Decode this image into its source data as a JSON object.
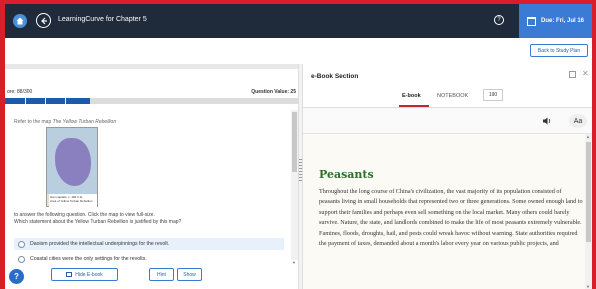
{
  "topbar": {
    "title": "LearningCurve for Chapter 5",
    "help_glyph": "?",
    "due_label": "Due: Fri, Jul 16"
  },
  "study_plan_button": "Back to Study Plan",
  "score": {
    "label": "ore: 88/300",
    "question_value": "Question Value: 25",
    "progress_fraction": 0.29
  },
  "question": {
    "refer_prefix": "Refer to the map ",
    "refer_italic": "The Yellow Turban Rebellion",
    "map_legend_1": "Han capitals, c. 184 C.E.",
    "map_legend_2": "Area of Yellow Turban Rebellion",
    "instruction_1": "to answer the following question. Click the map to view full-size.",
    "instruction_2": "Which statement about the Yellow Turban Rebellion is justified by this map?",
    "options": [
      "Daoism provided the intellectual underpinnings for the revolt.",
      "Coastal cities were the only settings for the revolts."
    ]
  },
  "buttons": {
    "hide_ebook": "Hide E-book",
    "hint": "Hint",
    "show": "Show"
  },
  "help_fab": "?",
  "ebook": {
    "section_title": "e-Book Section",
    "tab_ebook": "E-book",
    "tab_notebook": "NOTEBOOK",
    "page": "190",
    "font_button": "Aa",
    "heading": "Peasants",
    "body": "Throughout the long course of China's civilization, the vast majority of its population consisted of peasants living in small households that represented two or three generations. Some owned enough land to support their families and perhaps even sell something on the local market. Many others could barely survive. Nature, the state, and landlords combined to make the life of most peasants extremely vulnerable. Famines, floods, droughts, hail, and pests could wreak havoc without warning. State authorities required the payment of taxes, demanded about a month's labor every year on various public projects, and"
  },
  "colors": {
    "frame_red": "#d81e2a",
    "topbar": "#1f2a3a",
    "due_blue": "#3a7bd5",
    "heading_green": "#2c6e2c"
  }
}
